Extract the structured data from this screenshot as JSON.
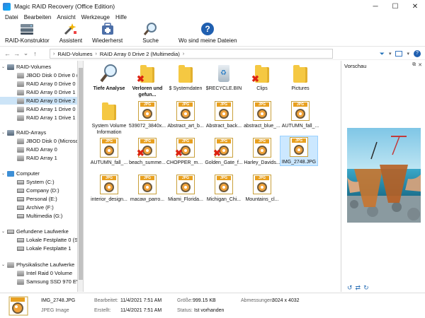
{
  "window": {
    "title": "Magic RAID Recovery (Office Edition)",
    "minimize": "─",
    "maximize": "☐",
    "close": "✕"
  },
  "menu": [
    "Datei",
    "Bearbeiten",
    "Ansicht",
    "Werkzeuge",
    "Hilfe"
  ],
  "ribbon": {
    "raid_constructor": "RAID-Konstruktor",
    "wizard": "Assistent",
    "restore": "Wiederherst",
    "search": "Suche",
    "where_files": "Wo sind meine Dateien"
  },
  "address": {
    "crumbs": [
      "RAID-Volumes",
      "RAID Array 0 Drive 2 (Multimedia)"
    ]
  },
  "tree": {
    "g1": {
      "label": "RAID-Volumes",
      "items": [
        "JBOD Disk 0 Drive 0 (",
        "RAID Array 0 Drive 0",
        "RAID Array 0 Drive 1",
        "RAID Array 0 Drive 2",
        "RAID Array 1 Drive 0",
        "RAID Array 1 Drive 1"
      ]
    },
    "g2": {
      "label": "RAID-Arrays",
      "items": [
        "JBOD Disk 0 (Microsc",
        "RAID Array 0",
        "RAID Array 1"
      ]
    },
    "g3": {
      "label": "Computer",
      "items": [
        "System (C:)",
        "Company (D:)",
        "Personal (E:)",
        "Archive (F:)",
        "Multimedia (G:)"
      ]
    },
    "g4": {
      "label": "Gefundene Laufwerke",
      "items": [
        "Lokale Festplatte 0 (S",
        "Lokale Festplatte 1"
      ]
    },
    "g5": {
      "label": "Physikalische Laufwerke",
      "items": [
        "Intel Raid 0 Volume",
        "Samsung SSD 970 EV"
      ]
    }
  },
  "files": [
    "Tiefe Analyse",
    "Verloren und gefun...",
    "$ Systemdaten",
    "$RECYCLE.BIN",
    "Clips",
    "Pictures",
    "System Volume Information",
    "539072_3840x...",
    "Abstract_art_b...",
    "Abstract_back...",
    "abstract_blue_...",
    "AUTUMN_fall_...",
    "AUTUMN_fall_...",
    "beach_summe...",
    "CHOPPER_mo...",
    "Golden_Gate_f...",
    "Harley_Davids...",
    "IMG_2748.JPG",
    "interior_design...",
    "macaw_parro...",
    "Miami_Florida...",
    "Michigan_Chi...",
    "Mountains_cl..."
  ],
  "jpg_tag": "JPG",
  "preview": {
    "title": "Vorschau"
  },
  "status": {
    "filename": "IMG_2748.JPG",
    "filetype": "JPEG Image",
    "modified_label": "Bearbeitet:",
    "modified": "11/4/2021 7:51 AM",
    "created_label": "Erstellt:",
    "created": "11/4/2021 7:51 AM",
    "size_label": "Größe:",
    "size": "999.15 KB",
    "status_label": "Status:",
    "status": "Ist vorhanden",
    "dims_label": "Abmessungen:",
    "dims": "3024 x 4032"
  }
}
